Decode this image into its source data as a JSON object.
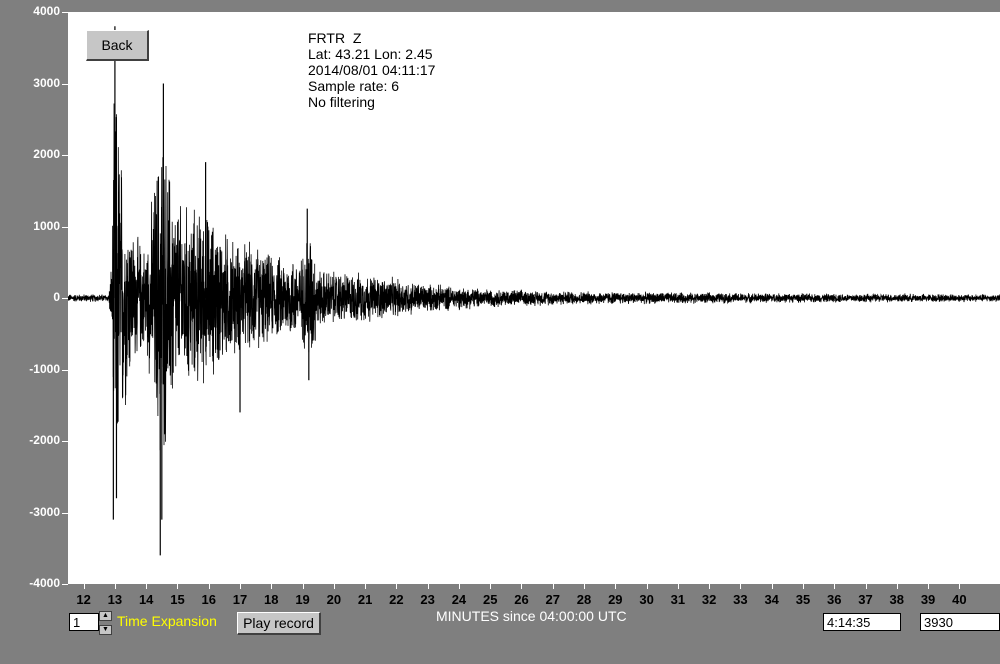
{
  "station": {
    "name": "FRTR  Z",
    "location": "Lat: 43.21 Lon: 2.45",
    "datetime": "2014/08/01 04:11:17",
    "sample_rate": "Sample rate: 6",
    "filtering": "No filtering"
  },
  "buttons": {
    "back": "Back",
    "play": "Play record"
  },
  "controls": {
    "time_expansion_value": "1",
    "time_expansion_label": "Time Expansion",
    "cursor_time": "4:14:35",
    "cursor_sample": "3930"
  },
  "colors": {
    "background": "#7f7f7f",
    "plot": "#ffffff",
    "trace": "#000000",
    "label_highlight": "#ffff00"
  },
  "chart_data": {
    "type": "line",
    "xlabel": "MINUTES since 04:00:00 UTC",
    "ylabel": "",
    "xlim": [
      11.5,
      41.3
    ],
    "ylim": [
      -4000,
      4000
    ],
    "y_ticks": [
      "4000",
      "3000",
      "2000",
      "1000",
      "0",
      "-1000",
      "-2000",
      "-3000",
      "-4000"
    ],
    "x_ticks": [
      "12",
      "13",
      "14",
      "15",
      "16",
      "17",
      "18",
      "19",
      "20",
      "21",
      "22",
      "23",
      "24",
      "25",
      "26",
      "27",
      "28",
      "29",
      "30",
      "31",
      "32",
      "33",
      "34",
      "35",
      "36",
      "37",
      "38",
      "39",
      "40"
    ],
    "envelope": {
      "x": [
        11.5,
        12.8,
        12.9,
        13.0,
        13.1,
        13.3,
        13.6,
        14.0,
        14.4,
        14.5,
        14.6,
        15.0,
        15.5,
        16.0,
        16.5,
        17.0,
        17.5,
        18.0,
        18.5,
        19.0,
        19.2,
        19.5,
        20.0,
        21.0,
        22.0,
        23.0,
        24.0,
        25.0,
        27.0,
        30.0,
        35.0,
        41.3
      ],
      "y": [
        60,
        60,
        600,
        3800,
        2900,
        1800,
        1000,
        800,
        2400,
        3000,
        2400,
        1500,
        1400,
        1300,
        1050,
        850,
        850,
        650,
        650,
        650,
        1250,
        450,
        420,
        380,
        300,
        220,
        180,
        140,
        110,
        90,
        70,
        60
      ]
    },
    "peaks": [
      {
        "x": 13.0,
        "y": 3800
      },
      {
        "x": 12.95,
        "y": -3100
      },
      {
        "x": 13.05,
        "y": -2800
      },
      {
        "x": 14.45,
        "y": -3600
      },
      {
        "x": 14.55,
        "y": 3000
      },
      {
        "x": 14.5,
        "y": -3100
      },
      {
        "x": 19.15,
        "y": 1250
      },
      {
        "x": 19.2,
        "y": -1150
      },
      {
        "x": 15.9,
        "y": 1900
      },
      {
        "x": 17.0,
        "y": -1600
      }
    ]
  }
}
